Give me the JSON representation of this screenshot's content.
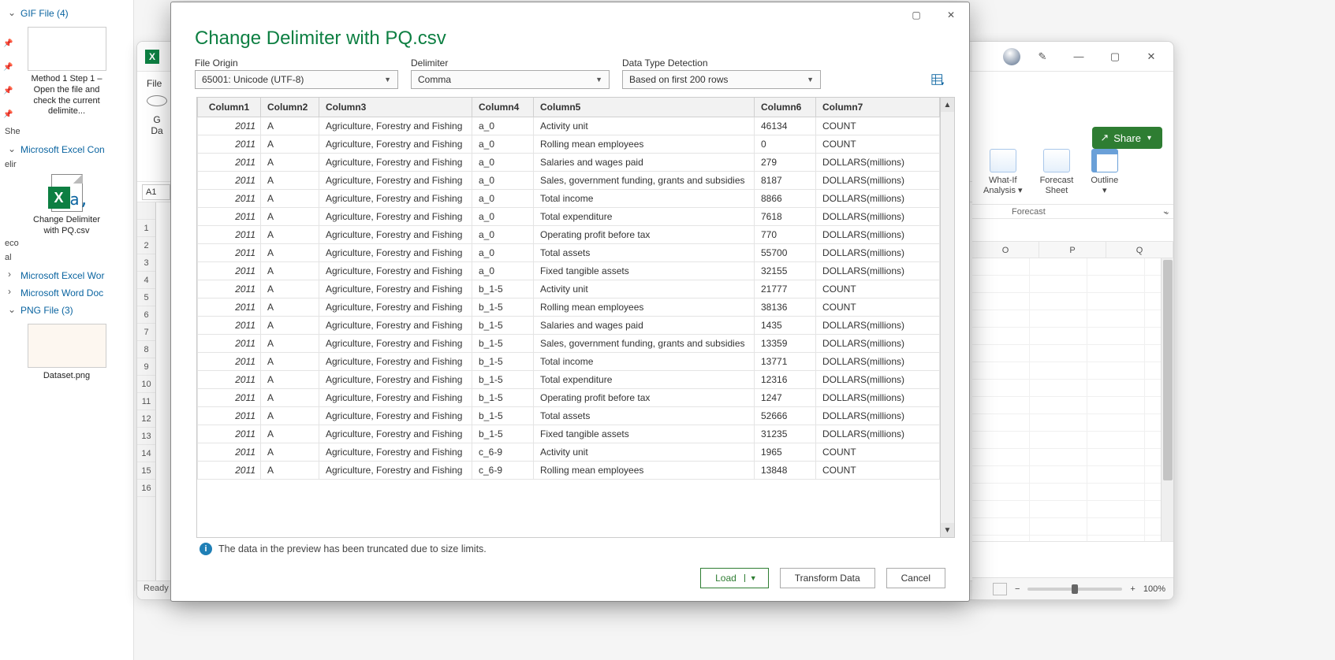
{
  "left_panel": {
    "groups": {
      "gif": "GIF File (4)",
      "xls_csv": "Microsoft Excel Con",
      "xls_ws": "Microsoft Excel Wor",
      "word": "Microsoft Word Doc",
      "png": "PNG File (3)"
    },
    "tiles": {
      "method1": "Method 1 Step 1 – Open the file and check the current delimite...",
      "csv": "Change Delimiter with PQ.csv",
      "png": "Dataset.png"
    },
    "cut_labels": [
      "She",
      "elir",
      "eco",
      "al"
    ]
  },
  "excel": {
    "file_tab": "File",
    "get_data_stub1": "G",
    "get_data_stub2": "Da",
    "namebox": "A1",
    "status": "Ready",
    "share": "Share",
    "forecast": {
      "whatif_a": "What-If",
      "whatif_b": "Analysis",
      "sheet_a": "Forecast",
      "sheet_b": "Sheet",
      "outline": "Outline",
      "group_label": "Forecast"
    },
    "right_cols": [
      "O",
      "P",
      "Q"
    ],
    "zoom": "100%"
  },
  "dialog": {
    "title": "Change Delimiter with PQ.csv",
    "labels": {
      "file_origin": "File Origin",
      "delimiter": "Delimiter",
      "detect": "Data Type Detection"
    },
    "values": {
      "file_origin": "65001: Unicode (UTF-8)",
      "delimiter": "Comma",
      "detect": "Based on first 200 rows"
    },
    "columns": [
      "Column1",
      "Column2",
      "Column3",
      "Column4",
      "Column5",
      "Column6",
      "Column7"
    ],
    "rows": [
      [
        "2011",
        "A",
        "Agriculture, Forestry and Fishing",
        "a_0",
        "Activity unit",
        "46134",
        "COUNT"
      ],
      [
        "2011",
        "A",
        "Agriculture, Forestry and Fishing",
        "a_0",
        "Rolling mean employees",
        "0",
        "COUNT"
      ],
      [
        "2011",
        "A",
        "Agriculture, Forestry and Fishing",
        "a_0",
        "Salaries and wages paid",
        "279",
        "DOLLARS(millions)"
      ],
      [
        "2011",
        "A",
        "Agriculture, Forestry and Fishing",
        "a_0",
        "Sales, government funding, grants and subsidies",
        "8187",
        "DOLLARS(millions)"
      ],
      [
        "2011",
        "A",
        "Agriculture, Forestry and Fishing",
        "a_0",
        "Total income",
        "8866",
        "DOLLARS(millions)"
      ],
      [
        "2011",
        "A",
        "Agriculture, Forestry and Fishing",
        "a_0",
        "Total expenditure",
        "7618",
        "DOLLARS(millions)"
      ],
      [
        "2011",
        "A",
        "Agriculture, Forestry and Fishing",
        "a_0",
        "Operating profit before tax",
        "770",
        "DOLLARS(millions)"
      ],
      [
        "2011",
        "A",
        "Agriculture, Forestry and Fishing",
        "a_0",
        "Total assets",
        "55700",
        "DOLLARS(millions)"
      ],
      [
        "2011",
        "A",
        "Agriculture, Forestry and Fishing",
        "a_0",
        "Fixed tangible assets",
        "32155",
        "DOLLARS(millions)"
      ],
      [
        "2011",
        "A",
        "Agriculture, Forestry and Fishing",
        "b_1-5",
        "Activity unit",
        "21777",
        "COUNT"
      ],
      [
        "2011",
        "A",
        "Agriculture, Forestry and Fishing",
        "b_1-5",
        "Rolling mean employees",
        "38136",
        "COUNT"
      ],
      [
        "2011",
        "A",
        "Agriculture, Forestry and Fishing",
        "b_1-5",
        "Salaries and wages paid",
        "1435",
        "DOLLARS(millions)"
      ],
      [
        "2011",
        "A",
        "Agriculture, Forestry and Fishing",
        "b_1-5",
        "Sales, government funding, grants and subsidies",
        "13359",
        "DOLLARS(millions)"
      ],
      [
        "2011",
        "A",
        "Agriculture, Forestry and Fishing",
        "b_1-5",
        "Total income",
        "13771",
        "DOLLARS(millions)"
      ],
      [
        "2011",
        "A",
        "Agriculture, Forestry and Fishing",
        "b_1-5",
        "Total expenditure",
        "12316",
        "DOLLARS(millions)"
      ],
      [
        "2011",
        "A",
        "Agriculture, Forestry and Fishing",
        "b_1-5",
        "Operating profit before tax",
        "1247",
        "DOLLARS(millions)"
      ],
      [
        "2011",
        "A",
        "Agriculture, Forestry and Fishing",
        "b_1-5",
        "Total assets",
        "52666",
        "DOLLARS(millions)"
      ],
      [
        "2011",
        "A",
        "Agriculture, Forestry and Fishing",
        "b_1-5",
        "Fixed tangible assets",
        "31235",
        "DOLLARS(millions)"
      ],
      [
        "2011",
        "A",
        "Agriculture, Forestry and Fishing",
        "c_6-9",
        "Activity unit",
        "1965",
        "COUNT"
      ],
      [
        "2011",
        "A",
        "Agriculture, Forestry and Fishing",
        "c_6-9",
        "Rolling mean employees",
        "13848",
        "COUNT"
      ]
    ],
    "info": "The data in the preview has been truncated due to size limits.",
    "buttons": {
      "load": "Load",
      "transform": "Transform Data",
      "cancel": "Cancel"
    }
  }
}
